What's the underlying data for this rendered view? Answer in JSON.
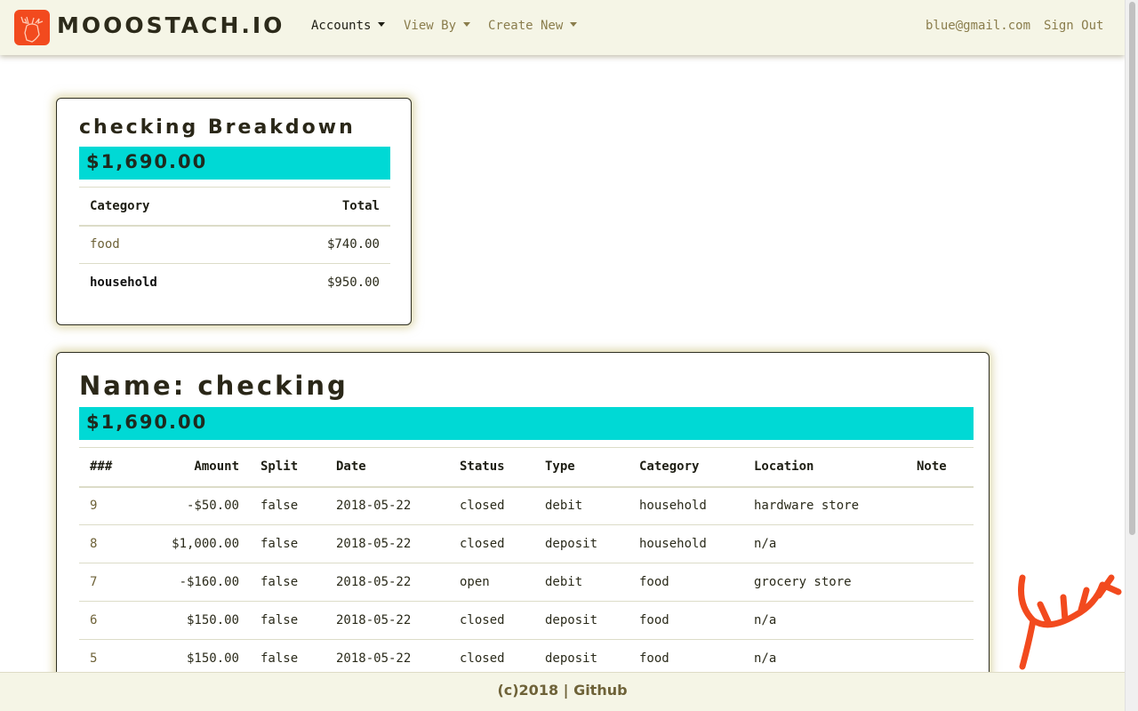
{
  "navbar": {
    "brand": "MOOOSTACH.IO",
    "logo_icon": "moose-icon",
    "logo_color": "#f24a1e",
    "menus": [
      {
        "label": "Accounts",
        "active": true
      },
      {
        "label": "View By",
        "active": false
      },
      {
        "label": "Create New",
        "active": false
      }
    ],
    "user_email": "blue@gmail.com",
    "sign_out": "Sign Out"
  },
  "breakdown": {
    "title": "checking Breakdown",
    "total": "$1,690.00",
    "columns": [
      "Category",
      "Total"
    ],
    "rows": [
      {
        "category": "food",
        "total": "$740.00"
      },
      {
        "category": "household",
        "total": "$950.00"
      }
    ]
  },
  "account": {
    "title": "Name: checking",
    "balance": "$1,690.00",
    "columns": [
      "###",
      "Amount",
      "Split",
      "Date",
      "Status",
      "Type",
      "Category",
      "Location",
      "Note"
    ],
    "rows": [
      {
        "id": "9",
        "amount": "-$50.00",
        "split": "false",
        "date": "2018-05-22",
        "status": "closed",
        "type": "debit",
        "category": "household",
        "location": "hardware store",
        "note": ""
      },
      {
        "id": "8",
        "amount": "$1,000.00",
        "split": "false",
        "date": "2018-05-22",
        "status": "closed",
        "type": "deposit",
        "category": "household",
        "location": "n/a",
        "note": ""
      },
      {
        "id": "7",
        "amount": "-$160.00",
        "split": "false",
        "date": "2018-05-22",
        "status": "open",
        "type": "debit",
        "category": "food",
        "location": "grocery store",
        "note": ""
      },
      {
        "id": "6",
        "amount": "$150.00",
        "split": "false",
        "date": "2018-05-22",
        "status": "closed",
        "type": "deposit",
        "category": "food",
        "location": "n/a",
        "note": ""
      },
      {
        "id": "5",
        "amount": "$150.00",
        "split": "false",
        "date": "2018-05-22",
        "status": "closed",
        "type": "deposit",
        "category": "food",
        "location": "n/a",
        "note": ""
      }
    ]
  },
  "footer": {
    "text": "(c)2018 | Github"
  },
  "colors": {
    "accent_banner": "#00d9d5",
    "nav_background": "#f5f5e6",
    "decor_moose": "#f24a1e"
  }
}
